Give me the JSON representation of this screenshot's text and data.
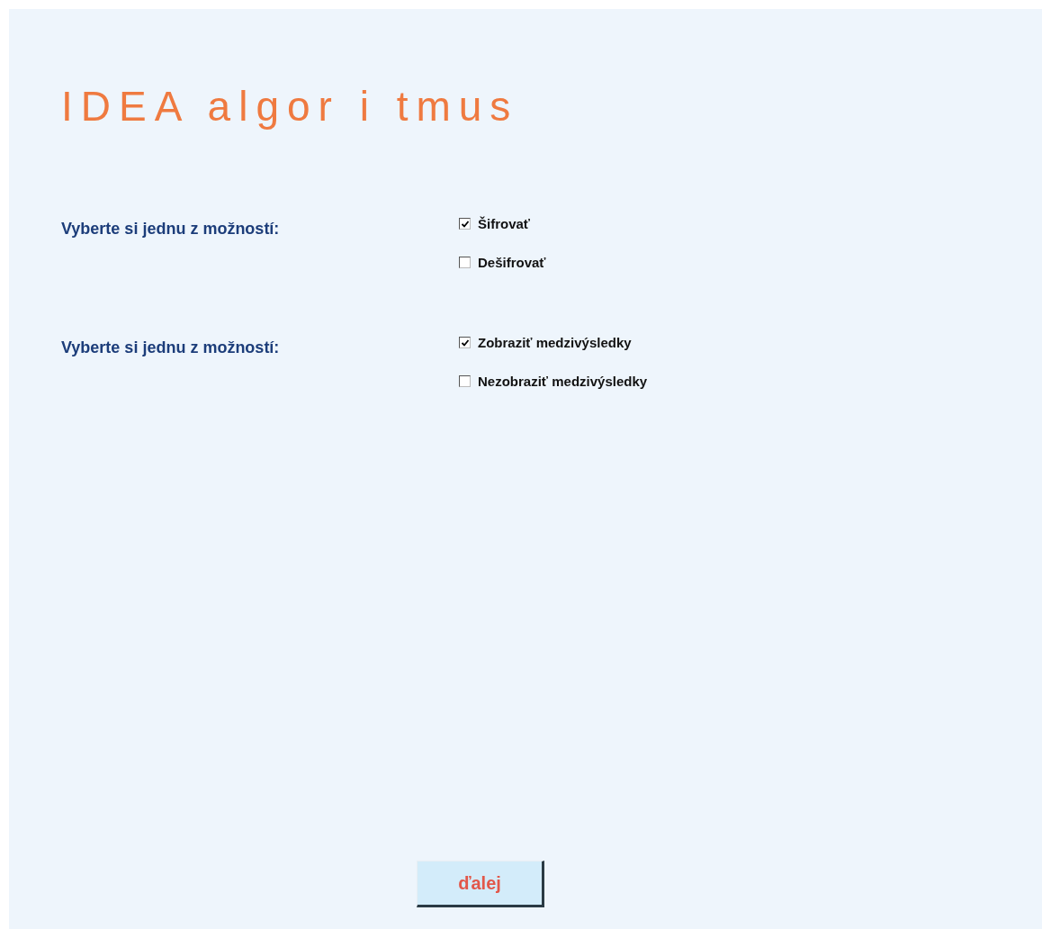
{
  "title": "IDEA algor i tmus",
  "groups": [
    {
      "label": "Vyberte si jednu z možností:",
      "options": [
        {
          "label": "Šifrovať",
          "checked": true
        },
        {
          "label": "Dešifrovať",
          "checked": false
        }
      ]
    },
    {
      "label": "Vyberte si jednu z možností:",
      "options": [
        {
          "label": "Zobraziť medzivýsledky",
          "checked": true
        },
        {
          "label": "Nezobraziť medzivýsledky",
          "checked": false
        }
      ]
    }
  ],
  "button": "ďalej"
}
